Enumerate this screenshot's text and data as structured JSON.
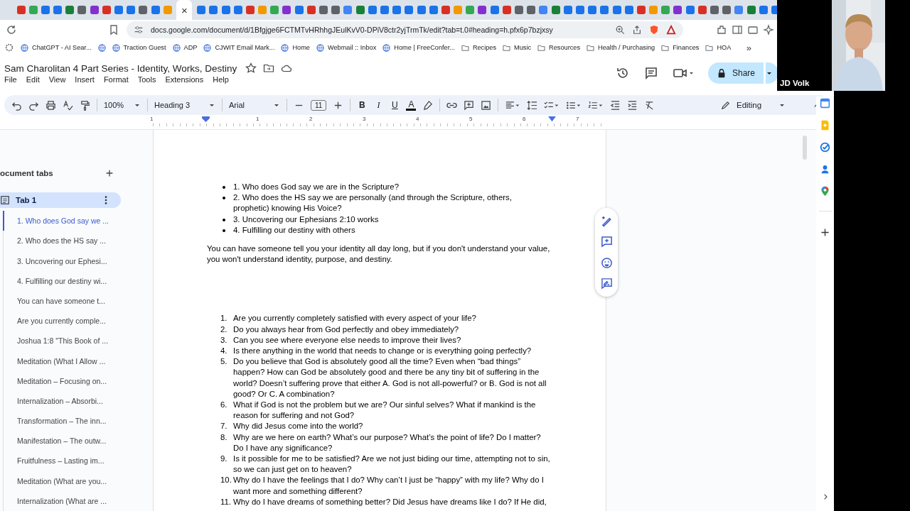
{
  "browser": {
    "close_tab": "×",
    "url": "docs.google.com/document/d/1Bfgjge6FCTMTvHRhhgJEulKvV0-DPiV8ctr2yjTrmTk/edit?tab=t.0#heading=h.pfx6p7bzjxsy",
    "bookmarks": [
      {
        "label": "ChatGPT - AI Sear...",
        "kind": "site"
      },
      {
        "kind": "site"
      },
      {
        "label": "Traction Guest",
        "kind": "site"
      },
      {
        "label": "ADP",
        "kind": "site"
      },
      {
        "label": "CJWIT Email Mark...",
        "kind": "site"
      },
      {
        "label": "Home",
        "kind": "site"
      },
      {
        "label": "Webmail :: Inbox",
        "kind": "site"
      },
      {
        "label": "Home | FreeConfer...",
        "kind": "site"
      },
      {
        "label": "Recipes",
        "kind": "folder"
      },
      {
        "label": "Music",
        "kind": "folder"
      },
      {
        "label": "Resources",
        "kind": "folder"
      },
      {
        "label": "Health / Purchasing",
        "kind": "folder"
      },
      {
        "label": "Finances",
        "kind": "folder"
      },
      {
        "label": "HOA",
        "kind": "folder"
      }
    ],
    "more": "»"
  },
  "document": {
    "title": "Sam Charolitan 4 Part Series - Identity, Works, Destiny",
    "menu": [
      "File",
      "Edit",
      "View",
      "Insert",
      "Format",
      "Tools",
      "Extensions",
      "Help"
    ],
    "share": "Share"
  },
  "toolbar": {
    "zoom": "100%",
    "style": "Heading 3",
    "font": "Arial",
    "size": "11",
    "bold": "B",
    "italic": "I",
    "underline": "U",
    "text_color": "A",
    "mode": "Editing"
  },
  "ruler": [
    "1",
    "1",
    "2",
    "3",
    "4",
    "5",
    "6",
    "7"
  ],
  "sidebar": {
    "heading": "ocument tabs",
    "tab": {
      "label": "Tab 1",
      "selected": true
    },
    "outline": [
      {
        "label": "1. Who does God say we ...",
        "selected": true
      },
      {
        "label": "2. Who does the HS say ...",
        "selected": false
      },
      {
        "label": "3. Uncovering our Ephesi...",
        "selected": false
      },
      {
        "label": "4. Fulfilling our destiny wi...",
        "selected": false
      },
      {
        "label": "You can have someone t...",
        "selected": false
      },
      {
        "label": "Are you currently comple...",
        "selected": false
      },
      {
        "label": "Joshua 1:8 \"This Book of ...",
        "selected": false
      },
      {
        "label": "Meditation (What I Allow ...",
        "selected": false
      },
      {
        "label": "Meditation – Focusing on...",
        "selected": false
      },
      {
        "label": "Internalization – Absorbi...",
        "selected": false
      },
      {
        "label": "Transformation – The inn...",
        "selected": false
      },
      {
        "label": "Manifestation – The outw...",
        "selected": false
      },
      {
        "label": "Fruitfulness – Lasting im...",
        "selected": false
      },
      {
        "label": "Meditation (What are you...",
        "selected": false
      },
      {
        "label": "Internalization (What are ...",
        "selected": false
      }
    ]
  },
  "page": {
    "bullets": [
      "1.  Who does God say we are in the Scripture?",
      "2.  Who does the HS say we are personally (and through the Scripture, others, prophetic) knowing His Voice?",
      "3.  Uncovering our Ephesians 2:10 works",
      "4.  Fulfilling our destiny with others"
    ],
    "paragraph": "You can have someone tell you your identity all day long, but if you don't understand your value, you won't understand identity, purpose, and destiny.",
    "questions": [
      {
        "number": "1.",
        "text": "Are you currently completely satisfied with every aspect of your life?"
      },
      {
        "number": "2.",
        "text": "Do you always hear from God perfectly and obey immediately?"
      },
      {
        "number": "3.",
        "text": "Can you see where everyone else needs to improve their lives?"
      },
      {
        "number": "4.",
        "text": "Is there anything in the world that needs to change or is everything going perfectly?"
      },
      {
        "number": "5.",
        "text": "Do you believe that God is absolutely good all the time?  Even when “bad things” happen?  How can God be absolutely good and there be any tiny bit of suffering in the world?  Doesn’t suffering prove that either A. God is not all-powerful? or B. God is not all good? Or C. A combination?"
      },
      {
        "number": "6.",
        "text": "What if God is not the problem but we are? Our sinful selves?  What if mankind is the reason for suffering and not God?"
      },
      {
        "number": "7.",
        "text": "Why did Jesus come into the world?"
      },
      {
        "number": "8.",
        "text": "Why are we here on earth?  What’s our purpose?  What’s the point of life?  Do I matter?  Do I  have any significance?"
      },
      {
        "number": "9.",
        "text": "Is it possible for me to be satisfied?  Are we not just biding our time, attempting not to sin, so we can just get on to heaven?"
      },
      {
        "number": "10.",
        "text": "Why do I have the feelings that I do?  Why can’t I just be “happy” with my life?  Why do I want more and something different?"
      },
      {
        "number": "11.",
        "text": "Why do I have dreams of something better?  Did Jesus have dreams like I do?  If He did,"
      }
    ]
  },
  "call": {
    "name": "JD Volk"
  }
}
